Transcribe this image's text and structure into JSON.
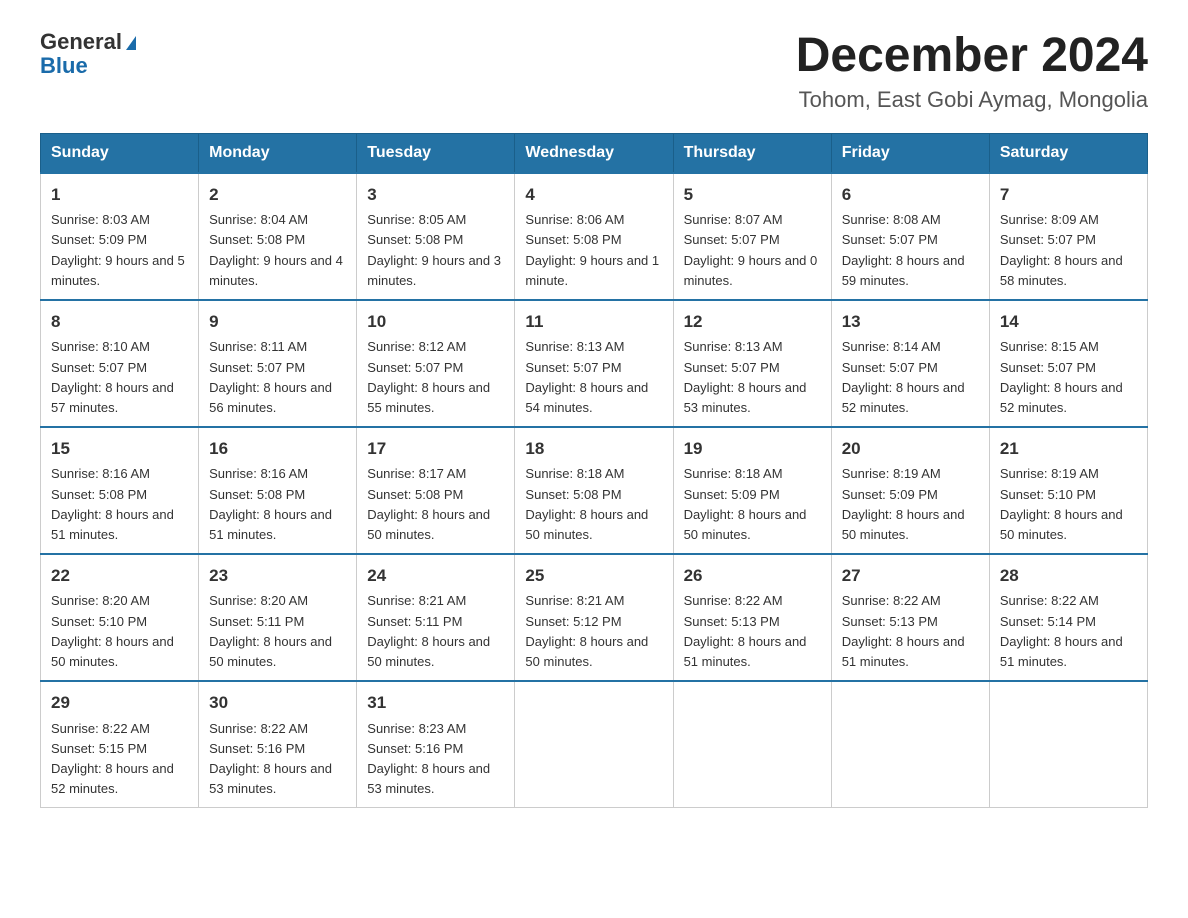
{
  "header": {
    "logo_general": "General",
    "logo_blue": "Blue",
    "title": "December 2024",
    "subtitle": "Tohom, East Gobi Aymag, Mongolia"
  },
  "days_of_week": [
    "Sunday",
    "Monday",
    "Tuesday",
    "Wednesday",
    "Thursday",
    "Friday",
    "Saturday"
  ],
  "weeks": [
    [
      {
        "day": "1",
        "sunrise": "Sunrise: 8:03 AM",
        "sunset": "Sunset: 5:09 PM",
        "daylight": "Daylight: 9 hours and 5 minutes."
      },
      {
        "day": "2",
        "sunrise": "Sunrise: 8:04 AM",
        "sunset": "Sunset: 5:08 PM",
        "daylight": "Daylight: 9 hours and 4 minutes."
      },
      {
        "day": "3",
        "sunrise": "Sunrise: 8:05 AM",
        "sunset": "Sunset: 5:08 PM",
        "daylight": "Daylight: 9 hours and 3 minutes."
      },
      {
        "day": "4",
        "sunrise": "Sunrise: 8:06 AM",
        "sunset": "Sunset: 5:08 PM",
        "daylight": "Daylight: 9 hours and 1 minute."
      },
      {
        "day": "5",
        "sunrise": "Sunrise: 8:07 AM",
        "sunset": "Sunset: 5:07 PM",
        "daylight": "Daylight: 9 hours and 0 minutes."
      },
      {
        "day": "6",
        "sunrise": "Sunrise: 8:08 AM",
        "sunset": "Sunset: 5:07 PM",
        "daylight": "Daylight: 8 hours and 59 minutes."
      },
      {
        "day": "7",
        "sunrise": "Sunrise: 8:09 AM",
        "sunset": "Sunset: 5:07 PM",
        "daylight": "Daylight: 8 hours and 58 minutes."
      }
    ],
    [
      {
        "day": "8",
        "sunrise": "Sunrise: 8:10 AM",
        "sunset": "Sunset: 5:07 PM",
        "daylight": "Daylight: 8 hours and 57 minutes."
      },
      {
        "day": "9",
        "sunrise": "Sunrise: 8:11 AM",
        "sunset": "Sunset: 5:07 PM",
        "daylight": "Daylight: 8 hours and 56 minutes."
      },
      {
        "day": "10",
        "sunrise": "Sunrise: 8:12 AM",
        "sunset": "Sunset: 5:07 PM",
        "daylight": "Daylight: 8 hours and 55 minutes."
      },
      {
        "day": "11",
        "sunrise": "Sunrise: 8:13 AM",
        "sunset": "Sunset: 5:07 PM",
        "daylight": "Daylight: 8 hours and 54 minutes."
      },
      {
        "day": "12",
        "sunrise": "Sunrise: 8:13 AM",
        "sunset": "Sunset: 5:07 PM",
        "daylight": "Daylight: 8 hours and 53 minutes."
      },
      {
        "day": "13",
        "sunrise": "Sunrise: 8:14 AM",
        "sunset": "Sunset: 5:07 PM",
        "daylight": "Daylight: 8 hours and 52 minutes."
      },
      {
        "day": "14",
        "sunrise": "Sunrise: 8:15 AM",
        "sunset": "Sunset: 5:07 PM",
        "daylight": "Daylight: 8 hours and 52 minutes."
      }
    ],
    [
      {
        "day": "15",
        "sunrise": "Sunrise: 8:16 AM",
        "sunset": "Sunset: 5:08 PM",
        "daylight": "Daylight: 8 hours and 51 minutes."
      },
      {
        "day": "16",
        "sunrise": "Sunrise: 8:16 AM",
        "sunset": "Sunset: 5:08 PM",
        "daylight": "Daylight: 8 hours and 51 minutes."
      },
      {
        "day": "17",
        "sunrise": "Sunrise: 8:17 AM",
        "sunset": "Sunset: 5:08 PM",
        "daylight": "Daylight: 8 hours and 50 minutes."
      },
      {
        "day": "18",
        "sunrise": "Sunrise: 8:18 AM",
        "sunset": "Sunset: 5:08 PM",
        "daylight": "Daylight: 8 hours and 50 minutes."
      },
      {
        "day": "19",
        "sunrise": "Sunrise: 8:18 AM",
        "sunset": "Sunset: 5:09 PM",
        "daylight": "Daylight: 8 hours and 50 minutes."
      },
      {
        "day": "20",
        "sunrise": "Sunrise: 8:19 AM",
        "sunset": "Sunset: 5:09 PM",
        "daylight": "Daylight: 8 hours and 50 minutes."
      },
      {
        "day": "21",
        "sunrise": "Sunrise: 8:19 AM",
        "sunset": "Sunset: 5:10 PM",
        "daylight": "Daylight: 8 hours and 50 minutes."
      }
    ],
    [
      {
        "day": "22",
        "sunrise": "Sunrise: 8:20 AM",
        "sunset": "Sunset: 5:10 PM",
        "daylight": "Daylight: 8 hours and 50 minutes."
      },
      {
        "day": "23",
        "sunrise": "Sunrise: 8:20 AM",
        "sunset": "Sunset: 5:11 PM",
        "daylight": "Daylight: 8 hours and 50 minutes."
      },
      {
        "day": "24",
        "sunrise": "Sunrise: 8:21 AM",
        "sunset": "Sunset: 5:11 PM",
        "daylight": "Daylight: 8 hours and 50 minutes."
      },
      {
        "day": "25",
        "sunrise": "Sunrise: 8:21 AM",
        "sunset": "Sunset: 5:12 PM",
        "daylight": "Daylight: 8 hours and 50 minutes."
      },
      {
        "day": "26",
        "sunrise": "Sunrise: 8:22 AM",
        "sunset": "Sunset: 5:13 PM",
        "daylight": "Daylight: 8 hours and 51 minutes."
      },
      {
        "day": "27",
        "sunrise": "Sunrise: 8:22 AM",
        "sunset": "Sunset: 5:13 PM",
        "daylight": "Daylight: 8 hours and 51 minutes."
      },
      {
        "day": "28",
        "sunrise": "Sunrise: 8:22 AM",
        "sunset": "Sunset: 5:14 PM",
        "daylight": "Daylight: 8 hours and 51 minutes."
      }
    ],
    [
      {
        "day": "29",
        "sunrise": "Sunrise: 8:22 AM",
        "sunset": "Sunset: 5:15 PM",
        "daylight": "Daylight: 8 hours and 52 minutes."
      },
      {
        "day": "30",
        "sunrise": "Sunrise: 8:22 AM",
        "sunset": "Sunset: 5:16 PM",
        "daylight": "Daylight: 8 hours and 53 minutes."
      },
      {
        "day": "31",
        "sunrise": "Sunrise: 8:23 AM",
        "sunset": "Sunset: 5:16 PM",
        "daylight": "Daylight: 8 hours and 53 minutes."
      },
      null,
      null,
      null,
      null
    ]
  ]
}
